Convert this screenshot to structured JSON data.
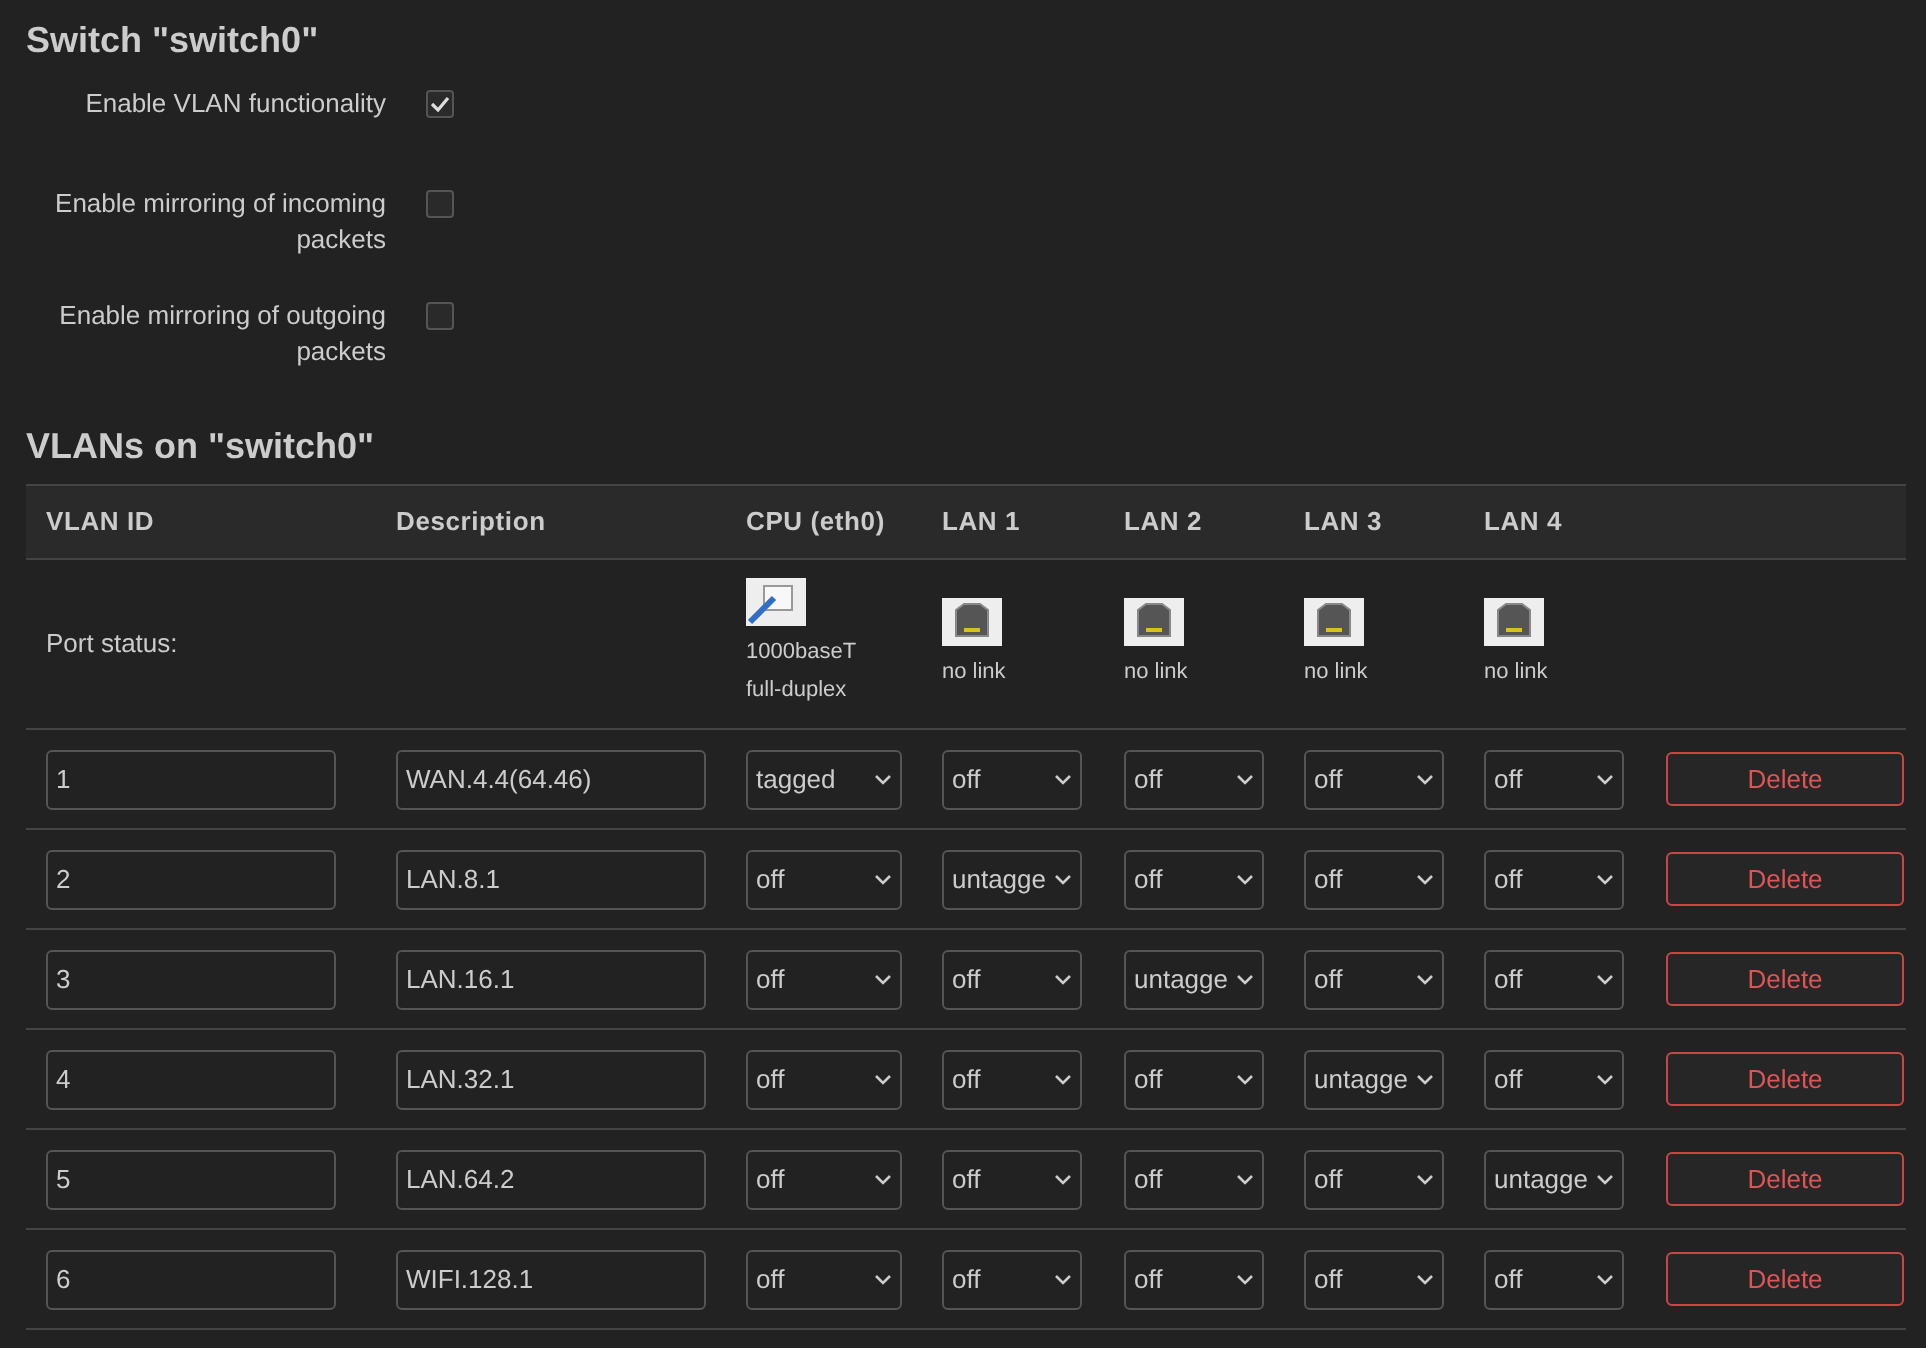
{
  "title": "Switch \"switch0\"",
  "options": [
    {
      "label": "Enable VLAN functionality",
      "checked": true
    },
    {
      "label": "Enable mirroring of incoming packets",
      "checked": false
    },
    {
      "label": "Enable mirroring of outgoing packets",
      "checked": false
    }
  ],
  "vlans_title": "VLANs on \"switch0\"",
  "table": {
    "columns": [
      "VLAN ID",
      "Description",
      "CPU (eth0)",
      "LAN 1",
      "LAN 2",
      "LAN 3",
      "LAN 4"
    ],
    "port_status": {
      "label": "Port status:",
      "ports": [
        {
          "kind": "cpu",
          "lines": [
            "1000baseT",
            "full-duplex"
          ]
        },
        {
          "kind": "rj45",
          "lines": [
            "no link"
          ]
        },
        {
          "kind": "rj45",
          "lines": [
            "no link"
          ]
        },
        {
          "kind": "rj45",
          "lines": [
            "no link"
          ]
        },
        {
          "kind": "rj45",
          "lines": [
            "no link"
          ]
        }
      ]
    },
    "rows": [
      {
        "vlan_id": "1",
        "description": "WAN.4.4(64.46)",
        "ports": [
          "tagged",
          "off",
          "off",
          "off",
          "off"
        ],
        "action": "Delete"
      },
      {
        "vlan_id": "2",
        "description": "LAN.8.1",
        "ports": [
          "off",
          "untagge",
          "off",
          "off",
          "off"
        ],
        "action": "Delete"
      },
      {
        "vlan_id": "3",
        "description": "LAN.16.1",
        "ports": [
          "off",
          "off",
          "untagge",
          "off",
          "off"
        ],
        "action": "Delete"
      },
      {
        "vlan_id": "4",
        "description": "LAN.32.1",
        "ports": [
          "off",
          "off",
          "off",
          "untagge",
          "off"
        ],
        "action": "Delete"
      },
      {
        "vlan_id": "5",
        "description": "LAN.64.2",
        "ports": [
          "off",
          "off",
          "off",
          "off",
          "untagge"
        ],
        "action": "Delete"
      },
      {
        "vlan_id": "6",
        "description": "WIFI.128.1",
        "ports": [
          "off",
          "off",
          "off",
          "off",
          "off"
        ],
        "action": "Delete"
      }
    ]
  }
}
